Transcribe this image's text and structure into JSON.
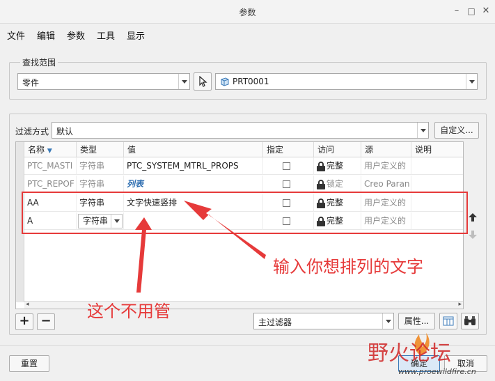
{
  "window": {
    "title": "参数",
    "minimize": "–",
    "maximize": "□",
    "close": "✕"
  },
  "menu": [
    "文件",
    "编辑",
    "参数",
    "工具",
    "显示"
  ],
  "scope": {
    "label": "查找范围",
    "type_value": "零件",
    "model_value": "PRT0001"
  },
  "filter": {
    "label": "过滤方式",
    "value": "默认",
    "customize": "自定义..."
  },
  "table": {
    "columns": [
      "名称",
      "类型",
      "值",
      "指定",
      "访问",
      "源",
      "说明"
    ],
    "rows": [
      {
        "name": "PTC_MASTI",
        "type": "字符串",
        "value": "PTC_SYSTEM_MTRL_PROPS",
        "access": "完整",
        "source": "用户定义的",
        "style": "gray"
      },
      {
        "name": "PTC_REPOF",
        "type": "字符串",
        "value": "列表",
        "access": "锁定",
        "source": "Creo Paran",
        "style": "gray"
      },
      {
        "name": "AA",
        "type": "字符串",
        "value": "文字快速竖排",
        "access": "完整",
        "source": "用户定义的",
        "style": "normal"
      },
      {
        "name": "A",
        "type": "字符串",
        "value": "",
        "access": "完整",
        "source": "用户定义的",
        "style": "normal"
      }
    ]
  },
  "bottom": {
    "add": "+",
    "remove": "−",
    "main_filter": "主过滤器",
    "properties": "属性..."
  },
  "footer": {
    "reset": "重置",
    "ok": "确定",
    "cancel": "取消"
  },
  "annotations": {
    "right": "输入你想排列的文字",
    "left": "这个不用管"
  },
  "watermark": {
    "text": "野火论坛",
    "url": "www.proewildfire.cn"
  },
  "colors": {
    "highlight_red": "#e63a3a",
    "link_blue": "#2b6cb0"
  }
}
